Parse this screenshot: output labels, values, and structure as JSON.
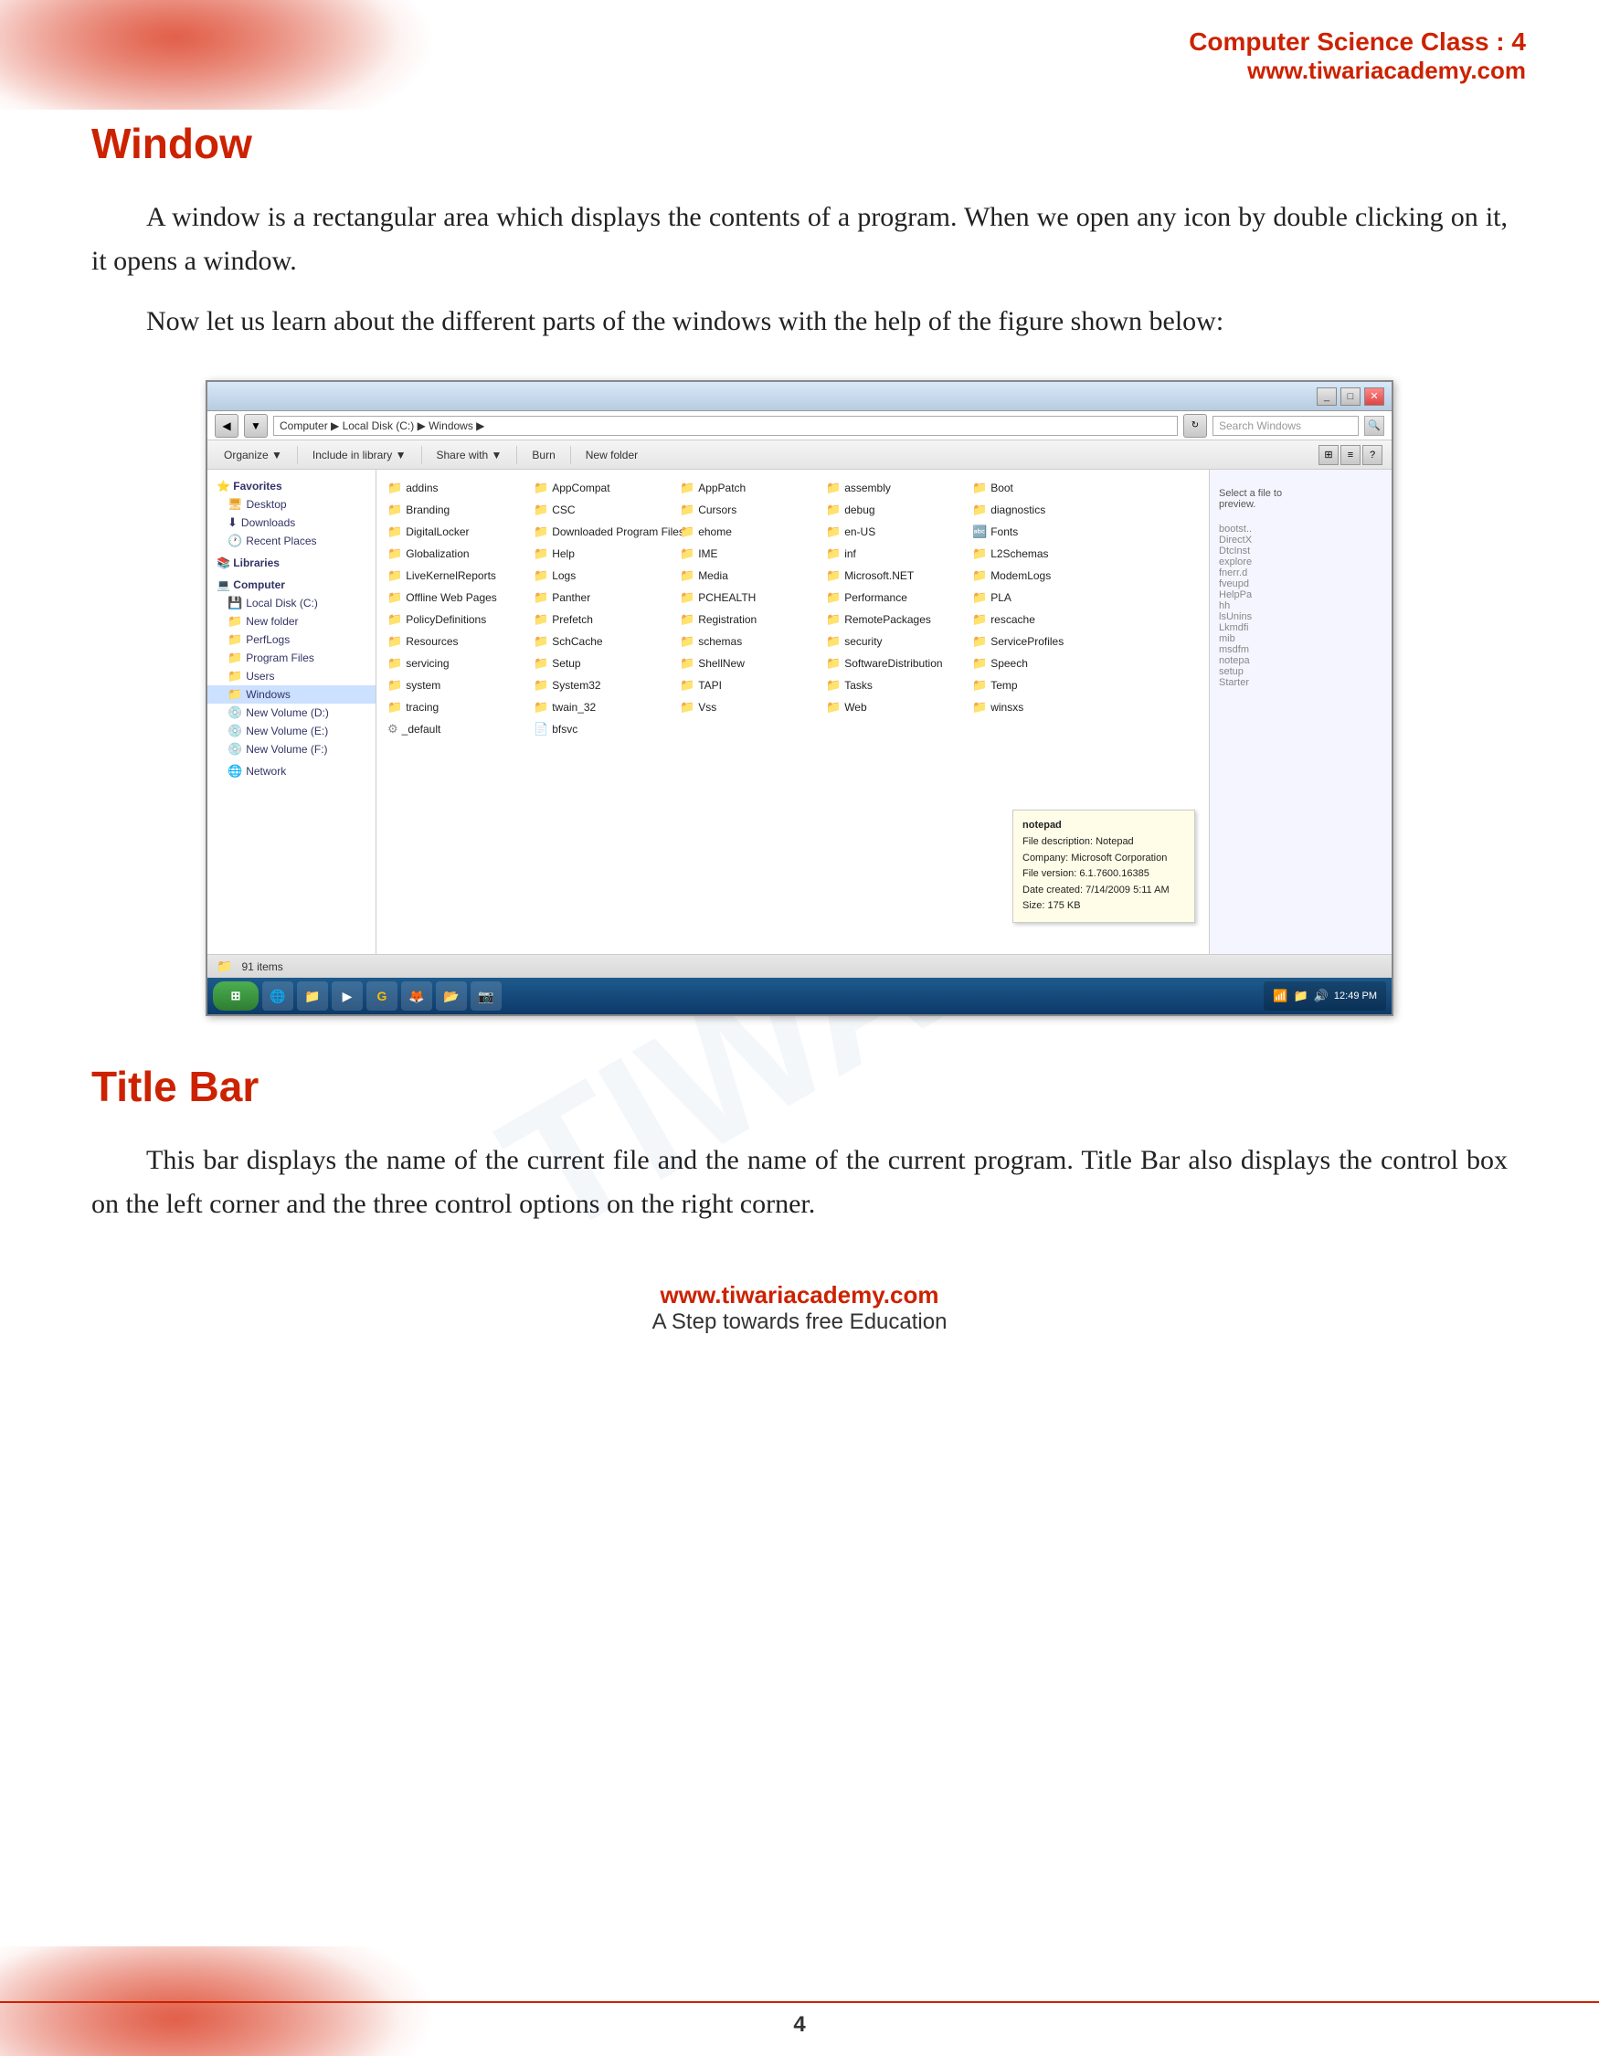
{
  "header": {
    "class_label": "Computer Science Class : 4",
    "website": "www.tiwariacademy.com"
  },
  "watermark": "TIWARI",
  "window_section": {
    "heading": "Window",
    "para1": "A window is a rectangular area which displays the contents of a program. When we open any icon by double clicking on it, it opens a window.",
    "para2": "Now let us learn about the different parts of the windows with the help of the figure shown below:"
  },
  "explorer": {
    "address_path": "Computer ▶ Local Disk (C:) ▶ Windows ▶",
    "search_placeholder": "Search Windows",
    "toolbar_items": [
      "Organize ▼",
      "Include in library ▼",
      "Share with ▼",
      "Burn",
      "New folder"
    ],
    "nav_items": [
      {
        "label": "Favorites",
        "type": "header"
      },
      {
        "label": "Desktop",
        "type": "item"
      },
      {
        "label": "Downloads",
        "type": "item"
      },
      {
        "label": "Recent Places",
        "type": "item"
      },
      {
        "label": "Libraries",
        "type": "header"
      },
      {
        "label": "Computer",
        "type": "header"
      },
      {
        "label": "Local Disk (C:)",
        "type": "item"
      },
      {
        "label": "New folder",
        "type": "item"
      },
      {
        "label": "PerfLogs",
        "type": "item"
      },
      {
        "label": "Program Files",
        "type": "item"
      },
      {
        "label": "Users",
        "type": "item"
      },
      {
        "label": "Windows",
        "type": "item",
        "selected": true
      },
      {
        "label": "New Volume (D:)",
        "type": "item"
      },
      {
        "label": "New Volume (E:)",
        "type": "item"
      },
      {
        "label": "New Volume (F:)",
        "type": "item"
      },
      {
        "label": "Network",
        "type": "item"
      }
    ],
    "files_col1": [
      "addins",
      "AppCompat",
      "AppPatch",
      "assembly",
      "Boot",
      "Branding",
      "CSC",
      "Cursors",
      "debug",
      "diagnostics",
      "DigitalLocker",
      "Downloaded Program Files",
      "ehome",
      "en-US",
      "Fonts",
      "Globalization",
      "Help",
      "IME",
      "inf"
    ],
    "files_col2": [
      "L2Schemas",
      "LiveKernelReports",
      "Logs",
      "Media",
      "Microsoft.NET",
      "ModemLogs",
      "Offline Web Pages",
      "Panther",
      "PCHEALTH",
      "Performance",
      "PLA",
      "PolicyDefinitions",
      "Prefetch",
      "Registration",
      "RemotePackages",
      "rescache",
      "Resources",
      "SchCache",
      "schemas"
    ],
    "files_col3": [
      "security",
      "ServiceProfiles",
      "servicing",
      "Setup",
      "ShellNew",
      "SoftwareDistribution",
      "Speech",
      "system",
      "System32",
      "TAPI",
      "Tasks",
      "Temp",
      "tracing",
      "twain_32",
      "Vss",
      "Web",
      "winsxs",
      "_default",
      "bfsvc"
    ],
    "files_col4": [
      "bootst..",
      "DirectX",
      "DtcInst",
      "explore",
      "fnerr.d",
      "fveupd",
      "HelpPa",
      "hh",
      "lsUnins",
      "Lkmdfi",
      "mib",
      "msdfm",
      "notepa",
      "setup",
      "Starter"
    ],
    "detail_text": "Select a file to preview.",
    "notepad_tooltip": {
      "title": "notepad",
      "file_desc": "File description: Notepad",
      "company": "Company: Microsoft Corporation",
      "version": "File version: 6.1.7600.16385",
      "date": "Date created: 7/14/2009 5:11 AM",
      "size": "Size: 175 KB"
    },
    "status_items_count": "91 items",
    "taskbar_time": "12:49 PM"
  },
  "titlebar_section": {
    "heading": "Title Bar",
    "para1": "This bar displays the name of the current file and the name of the current program.  Title Bar also displays the control box on the left corner and the three control options on the right corner."
  },
  "footer": {
    "website": "www.tiwariacademy.com",
    "tagline": "A Step towards free Education"
  },
  "page_number": "4"
}
